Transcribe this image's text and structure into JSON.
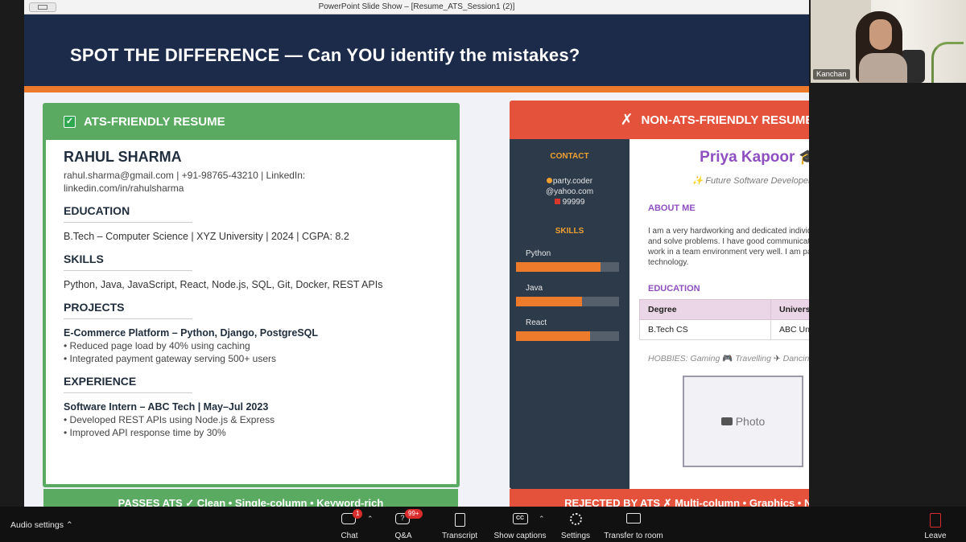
{
  "window": {
    "title": "PowerPoint Slide Show – [Resume_ATS_Session1 (2)]"
  },
  "slide": {
    "title": "SPOT THE DIFFERENCE — Can YOU identify the mistakes?",
    "ats_card": {
      "header": "ATS-FRIENDLY RESUME",
      "name": "RAHUL SHARMA",
      "contact_line1": "rahul.sharma@gmail.com  |  +91-98765-43210  |  LinkedIn:",
      "contact_line2": "linkedin.com/in/rahulsharma",
      "education_heading": "EDUCATION",
      "education_text": "B.Tech – Computer Science  |  XYZ University  |  2024  |  CGPA: 8.2",
      "skills_heading": "SKILLS",
      "skills_text": "Python, Java, JavaScript, React, Node.js, SQL, Git, Docker, REST APIs",
      "projects_heading": "PROJECTS",
      "project_title": "E-Commerce Platform – Python, Django, PostgreSQL",
      "project_bullets": [
        "• Reduced page load by 40% using caching",
        "• Integrated payment gateway serving 500+ users"
      ],
      "experience_heading": "EXPERIENCE",
      "experience_title": "Software Intern – ABC Tech  |  May–Jul 2023",
      "experience_bullets": [
        "• Developed REST APIs using Node.js & Express",
        "• Improved API response time by 30%"
      ],
      "footer": "PASSES ATS ✓  Clean • Single-column • Keyword-rich"
    },
    "non_ats_card": {
      "header_icon": "✗",
      "header": "NON-ATS-FRIENDLY RESUME",
      "contact_heading": "CONTACT",
      "contact_line1": "party.coder",
      "contact_line2": "@yahoo.com",
      "contact_line3": "99999",
      "skills_heading": "SKILLS",
      "skills": [
        {
          "label": "Python",
          "level": 0.82
        },
        {
          "label": "Java",
          "level": 0.64
        },
        {
          "label": "React",
          "level": 0.72
        }
      ],
      "name": "Priya Kapoor",
      "tagline": "Future Software Developer",
      "about_heading": "ABOUT ME",
      "about_text": "I am a very hardworking and dedicated individual who loves to code and solve problems. I have good communication skills and can work in a team environment very well. I am passionate about technology.",
      "education_heading": "EDUCATION",
      "table_headers": [
        "Degree",
        "University"
      ],
      "table_row": [
        "B.Tech CS",
        "ABC Univ"
      ],
      "hobbies_label": "HOBBIES:",
      "hobbies": [
        "Gaming",
        "Travelling",
        "Dancing"
      ],
      "photo_label": "Photo",
      "footer": "REJECTED BY ATS ✗  Multi-column • Graphics • No keywords"
    }
  },
  "webcam": {
    "name": "Kanchan"
  },
  "toolbar": {
    "audio_settings": "Audio settings",
    "chat": "Chat",
    "chat_badge": "1",
    "qa": "Q&A",
    "qa_badge": "99+",
    "transcript": "Transcript",
    "show_captions": "Show captions",
    "settings": "Settings",
    "transfer": "Transfer to room",
    "leave": "Leave"
  },
  "colors": {
    "slide_header": "#1c2b4a",
    "orange_accent": "#ec7a2b",
    "ats_green": "#5aaa62",
    "non_ats_red": "#e4523b",
    "name_purple": "#8e4fc1"
  }
}
